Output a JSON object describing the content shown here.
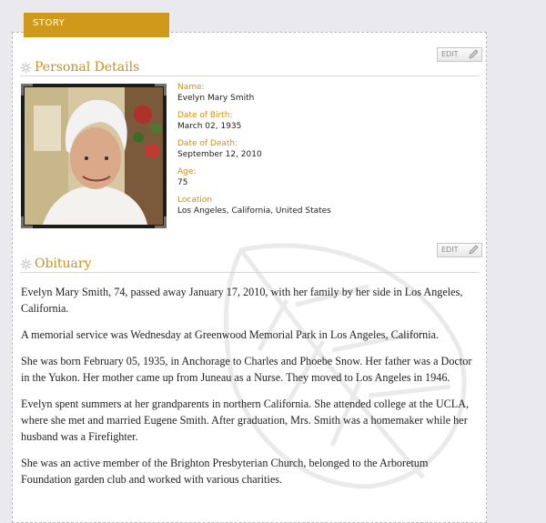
{
  "tab": {
    "label": "STORY"
  },
  "personal_details": {
    "title": "Personal Details",
    "edit_label": "EDIT",
    "fields": [
      {
        "label": "Name:",
        "value": "Evelyn Mary Smith"
      },
      {
        "label": "Date of Birth:",
        "value": "March 02, 1935"
      },
      {
        "label": "Date of Death:",
        "value": "September 12, 2010"
      },
      {
        "label": "Age:",
        "value": "75"
      },
      {
        "label": "Location",
        "value": "Los Angeles, California, United States"
      }
    ]
  },
  "obituary": {
    "title": "Obituary",
    "edit_label": "EDIT",
    "paragraphs": [
      "Evelyn Mary Smith, 74, passed away January 17, 2010, with her family by her side in Los Angeles, California.",
      "A memorial service was Wednesday at Greenwood Memorial Park in Los Angeles, California.",
      "She was born February 05, 1935, in Anchorage to Charles and Phoebe Snow. Her father was a Doctor in the Yukon. Her mother came up from Juneau as a Nurse.  They moved to Los Angeles in 1946.",
      "Evelyn spent summers at her grandparents in northern California. She attended college at the UCLA, where she met and married Eugene Smith. After graduation, Mrs. Smith was a homemaker while her husband was a Firefighter.",
      "She was an active member of the Brighton Presbyterian Church, belonged to the Arboretum Foundation garden club and worked with various charities."
    ]
  },
  "colors": {
    "accent": "#c8911b",
    "tab": "#cf9a1b",
    "text": "#222222"
  },
  "icons": {
    "section": "flower-icon",
    "edit": "pencil-icon",
    "watermark": "leaf-watermark"
  }
}
